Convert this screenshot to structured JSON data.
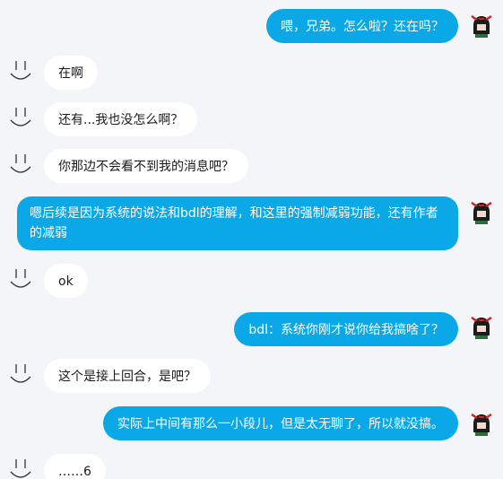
{
  "messages": [
    {
      "side": "out",
      "text": "喂，兄弟。怎么啦？还在吗？"
    },
    {
      "side": "in",
      "text": "在啊"
    },
    {
      "side": "in",
      "text": "还有...我也没怎么啊？"
    },
    {
      "side": "in",
      "text": "你那边不会看不到我的消息吧？"
    },
    {
      "side": "out",
      "text": "嗯后续是因为系统的说法和bdl的理解，和这里的强制减弱功能，还有作者的减弱"
    },
    {
      "side": "in",
      "text": "ok"
    },
    {
      "side": "out",
      "text": "bdl：系统你刚才说你给我搞啥了？"
    },
    {
      "side": "in",
      "text": "这个是接上回合，是吧？"
    },
    {
      "side": "out",
      "text": "实际上中间有那么一小段儿，但是太无聊了，所以就没搞。"
    },
    {
      "side": "in",
      "text": "……6"
    }
  ],
  "colors": {
    "background": "#f4f5f9",
    "incoming_bubble": "#ffffff",
    "outgoing_bubble": "#0aa8e6"
  },
  "icons": {
    "incoming_avatar": "smiley-face-icon",
    "outgoing_avatar": "anime-girl-avatar-icon"
  }
}
